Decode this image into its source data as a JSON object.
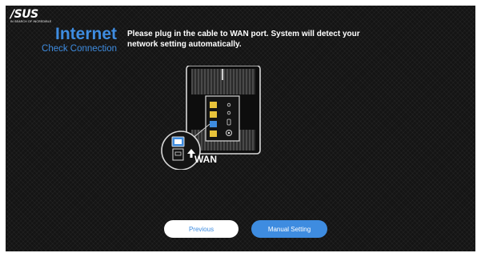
{
  "brand": {
    "logo_text": "/SUS",
    "tagline": "IN SEARCH OF INCREDIBLE"
  },
  "page": {
    "title": "Internet",
    "subtitle": "Check Connection"
  },
  "instruction": "Please plug in the cable to WAN port. System will detect your network setting automatically.",
  "illustration": {
    "port_label": "WAN",
    "icons": [
      "router-icon",
      "ethernet-port-icon",
      "monitor-icon",
      "plug-icon",
      "arrow-up-icon"
    ]
  },
  "buttons": {
    "previous": "Previous",
    "manual": "Manual Setting"
  },
  "colors": {
    "accent": "#3e8ce0",
    "background": "#141414",
    "lan_port": "#e8c33a",
    "wan_port": "#3e8ce0"
  }
}
